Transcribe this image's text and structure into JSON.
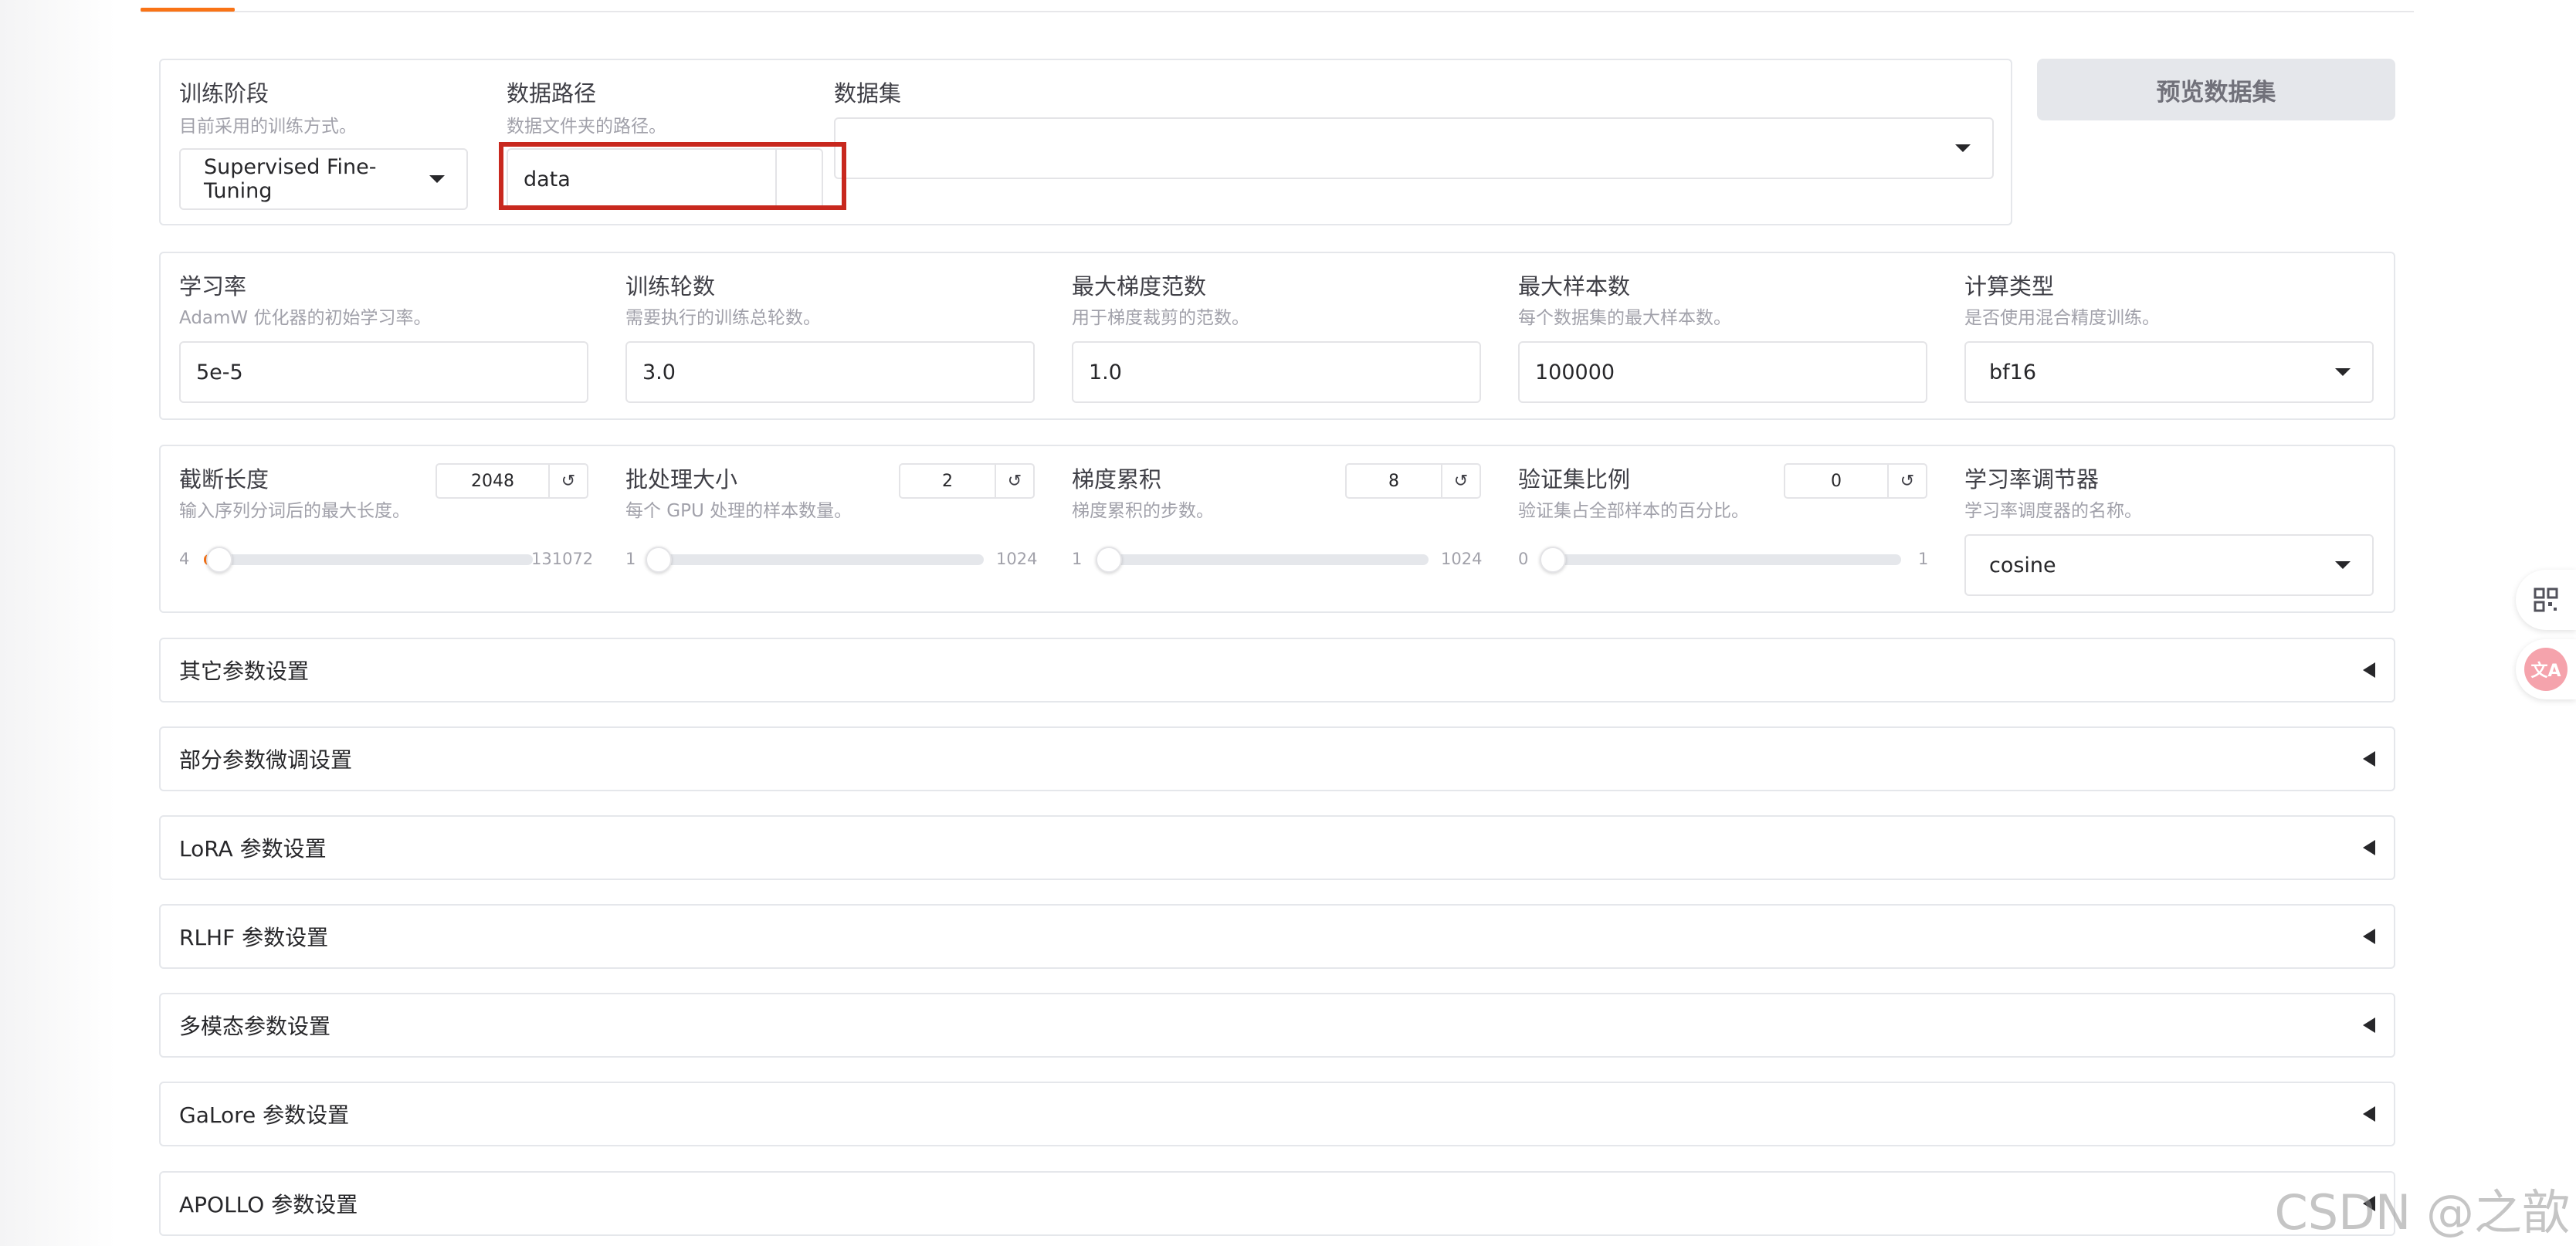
{
  "row1": {
    "stage": {
      "label": "训练阶段",
      "info": "目前采用的训练方式。",
      "value": "Supervised Fine-Tuning"
    },
    "data_path": {
      "label": "数据路径",
      "info": "数据文件夹的路径。",
      "value": "data"
    },
    "dataset": {
      "label": "数据集",
      "value": ""
    },
    "preview_button": "预览数据集"
  },
  "row2": {
    "learning_rate": {
      "label": "学习率",
      "info": "AdamW 优化器的初始学习率。",
      "value": "5e-5"
    },
    "epochs": {
      "label": "训练轮数",
      "info": "需要执行的训练总轮数。",
      "value": "3.0"
    },
    "max_grad_norm": {
      "label": "最大梯度范数",
      "info": "用于梯度裁剪的范数。",
      "value": "1.0"
    },
    "max_samples": {
      "label": "最大样本数",
      "info": "每个数据集的最大样本数。",
      "value": "100000"
    },
    "compute_type": {
      "label": "计算类型",
      "info": "是否使用混合精度训练。",
      "value": "bf16"
    }
  },
  "row3": {
    "cutoff_len": {
      "label": "截断长度",
      "info": "输入序列分词后的最大长度。",
      "value": "2048",
      "min": "4",
      "max": "131072",
      "fraction": 0.0156
    },
    "batch_size": {
      "label": "批处理大小",
      "info": "每个 GPU 处理的样本数量。",
      "value": "2",
      "min": "1",
      "max": "1024",
      "fraction": 0.001
    },
    "grad_accum": {
      "label": "梯度累积",
      "info": "梯度累积的步数。",
      "value": "8",
      "min": "1",
      "max": "1024",
      "fraction": 0.0068
    },
    "val_size": {
      "label": "验证集比例",
      "info": "验证集占全部样本的百分比。",
      "value": "0",
      "min": "0",
      "max": "1",
      "fraction": 0
    },
    "lr_scheduler": {
      "label": "学习率调节器",
      "info": "学习率调度器的名称。",
      "value": "cosine"
    }
  },
  "reset_symbol": "↺",
  "accordions": [
    "其它参数设置",
    "部分参数微调设置",
    "LoRA 参数设置",
    "RLHF 参数设置",
    "多模态参数设置",
    "GaLore 参数设置",
    "APOLLO 参数设置"
  ],
  "side_widgets": {
    "grid_icon": "qr-grid-icon",
    "translate_label": "文A"
  },
  "watermark": "CSDN @之歆",
  "colors": {
    "accent": "#f97316",
    "highlight": "#c8281e"
  }
}
